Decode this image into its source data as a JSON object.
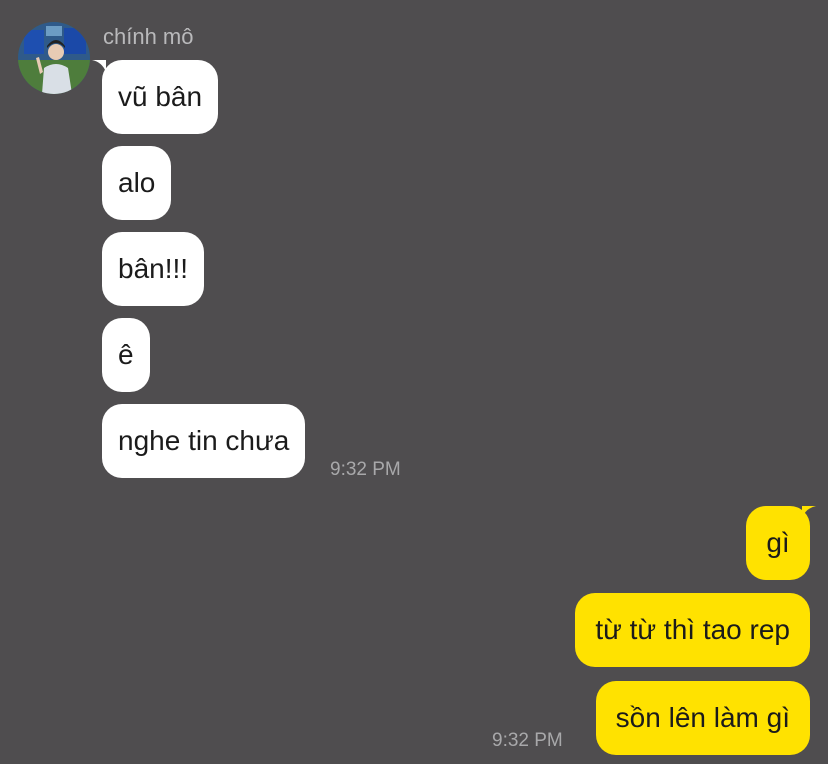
{
  "contact": {
    "name": "chính mô"
  },
  "incoming": [
    {
      "text": "vũ bân"
    },
    {
      "text": "alo"
    },
    {
      "text": "bân!!!"
    },
    {
      "text": "ê"
    },
    {
      "text": "nghe tin chưa"
    }
  ],
  "incoming_time": "9:32 PM",
  "outgoing": [
    {
      "text": "gì"
    },
    {
      "text": "từ từ thì tao rep"
    },
    {
      "text": "sồn lên làm gì"
    }
  ],
  "outgoing_time": "9:32 PM",
  "colors": {
    "background": "#4f4d4f",
    "incoming_bubble": "#ffffff",
    "outgoing_bubble": "#ffe200",
    "timestamp": "#a8a8aa",
    "name": "#b9b9bb"
  }
}
